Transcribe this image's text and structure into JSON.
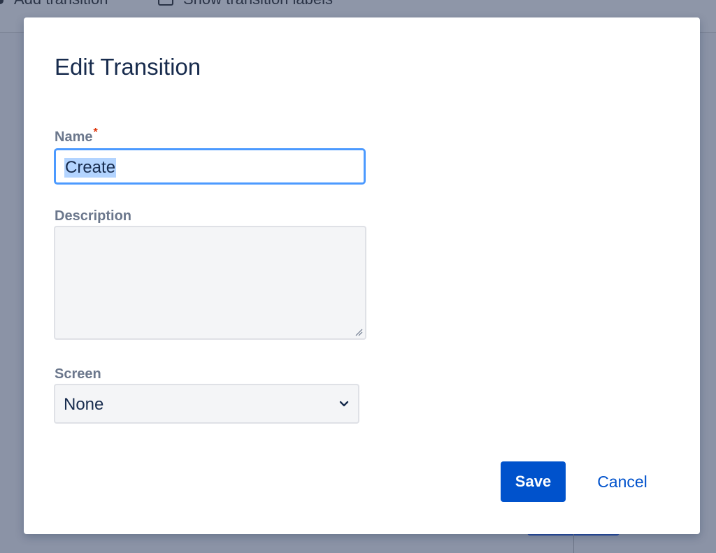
{
  "background": {
    "toolbar": {
      "add_transition_label": "Add transition",
      "show_labels_label": "Show transition labels"
    }
  },
  "dialog": {
    "title": "Edit Transition",
    "name": {
      "label": "Name",
      "required_mark": "*",
      "value": "Create"
    },
    "description": {
      "label": "Description",
      "value": ""
    },
    "screen": {
      "label": "Screen",
      "selected": "None"
    },
    "actions": {
      "save_label": "Save",
      "cancel_label": "Cancel"
    }
  },
  "colors": {
    "primary": "#0052cc",
    "focus_border": "#4c9aff",
    "required": "#de350b",
    "overlay": "#8b93a6"
  },
  "icons": {
    "select_arrow": "chevron-down-icon",
    "textarea_resize": "resize-handle-icon"
  }
}
